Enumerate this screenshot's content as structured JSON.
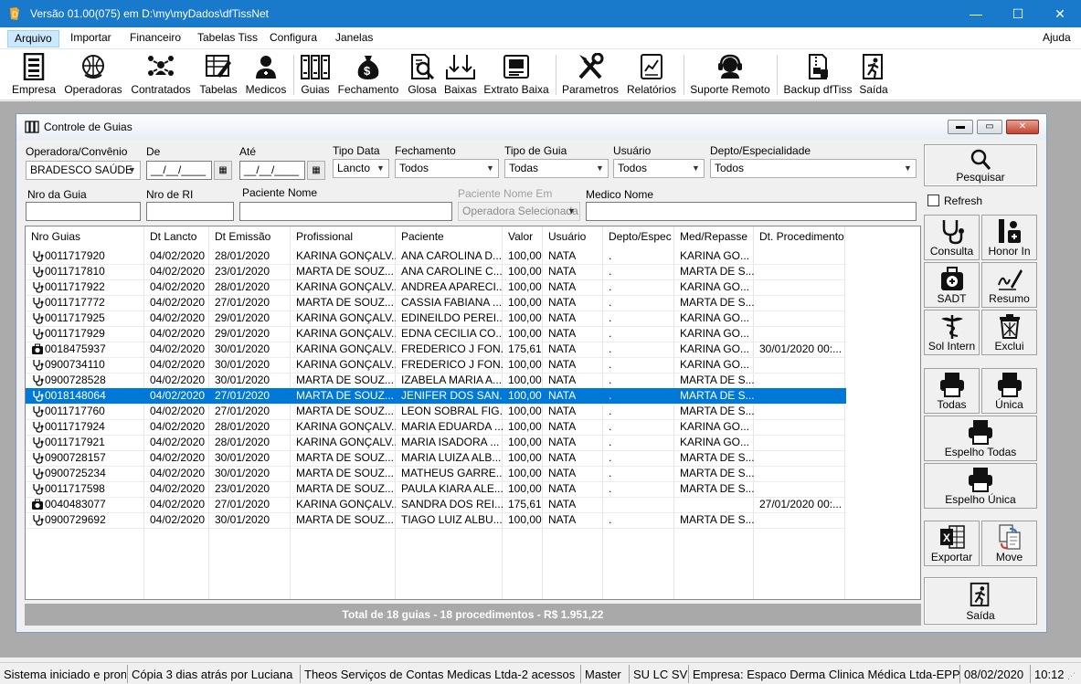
{
  "window": {
    "title": "Versão 01.00(075) em D:\\my\\myDados\\dfTissNet"
  },
  "menu": {
    "items": [
      "Arquivo",
      "Importar",
      "Financeiro",
      "Tabelas Tiss",
      "Configura",
      "Janelas"
    ],
    "help": "Ajuda"
  },
  "toolbar": {
    "items": [
      {
        "label": "Empresa",
        "icon": "building-list-icon"
      },
      {
        "label": "Operadoras",
        "icon": "globe-caduceus-icon"
      },
      {
        "label": "Contratados",
        "icon": "people-group-icon"
      },
      {
        "label": "Tabelas",
        "icon": "table-pencil-icon"
      },
      {
        "label": "Medicos",
        "icon": "doctor-icon"
      },
      {
        "label": "Guias",
        "icon": "guide-books-icon"
      },
      {
        "label": "Fechamento",
        "icon": "money-bag-icon"
      },
      {
        "label": "Glosa",
        "icon": "document-search-icon"
      },
      {
        "label": "Baixas",
        "icon": "download-arrows-icon"
      },
      {
        "label": "Extrato Baixa",
        "icon": "printer-statement-icon"
      },
      {
        "label": "Parametros",
        "icon": "tools-icon"
      },
      {
        "label": "Relatórios",
        "icon": "report-chart-icon"
      },
      {
        "label": "Suporte Remoto",
        "icon": "headset-support-icon"
      },
      {
        "label": "Backup dfTiss",
        "icon": "zip-backup-icon"
      },
      {
        "label": "Saída",
        "icon": "exit-running-icon"
      }
    ]
  },
  "child": {
    "title": "Controle de Guias",
    "filters": {
      "operadora_label": "Operadora/Convênio",
      "operadora_value": "BRADESCO SAÚDE",
      "de_label": "De",
      "de_value": "__/__/____",
      "ate_label": "Até",
      "ate_value": "__/__/____",
      "tipo_data_label": "Tipo Data",
      "tipo_data_value": "Lancto",
      "fechamento_label": "Fechamento",
      "fechamento_value": "Todos",
      "tipo_guia_label": "Tipo de Guia",
      "tipo_guia_value": "Todas",
      "usuario_label": "Usuário",
      "usuario_value": "Todos",
      "depto_label": "Depto/Especialidade",
      "depto_value": "Todos",
      "nro_guia_label": "Nro da Guia",
      "nro_ri_label": "Nro de RI",
      "paciente_label": "Paciente Nome",
      "paciente_em_label": "Paciente Nome Em",
      "paciente_em_value": "Operadora Selecionada",
      "medico_label": "Medico Nome",
      "refresh_label": "Refresh"
    },
    "grid": {
      "columns": [
        "Nro Guias",
        "Dt Lancto",
        "Dt Emissão",
        "Profissional",
        "Paciente",
        "Valor",
        "Usuário",
        "Depto/Espec",
        "Med/Repasse",
        "Dt. Procedimento"
      ],
      "rows": [
        {
          "icon": "stethoscope",
          "cells": [
            "0011717920",
            "04/02/2020",
            "28/01/2020",
            "KARINA GONÇALV...",
            "ANA CAROLINA D...",
            "100,00",
            "NATA",
            ".",
            "KARINA GO...",
            ""
          ]
        },
        {
          "icon": "stethoscope",
          "cells": [
            "0011717810",
            "04/02/2020",
            "23/01/2020",
            "MARTA DE SOUZ...",
            "ANA CAROLINE C...",
            "100,00",
            "NATA",
            ".",
            "MARTA DE S...",
            ""
          ]
        },
        {
          "icon": "stethoscope",
          "cells": [
            "0011717922",
            "04/02/2020",
            "28/01/2020",
            "KARINA GONÇALV...",
            "ANDREA APARECI...",
            "100,00",
            "NATA",
            ".",
            "KARINA GO...",
            ""
          ]
        },
        {
          "icon": "stethoscope",
          "cells": [
            "0011717772",
            "04/02/2020",
            "27/01/2020",
            "MARTA DE SOUZ...",
            "CASSIA FABIANA ...",
            "100,00",
            "NATA",
            ".",
            "MARTA DE S...",
            ""
          ]
        },
        {
          "icon": "stethoscope",
          "cells": [
            "0011717925",
            "04/02/2020",
            "29/01/2020",
            "KARINA GONÇALV...",
            "EDINEILDO PEREI...",
            "100,00",
            "NATA",
            ".",
            "KARINA GO...",
            ""
          ]
        },
        {
          "icon": "stethoscope",
          "cells": [
            "0011717929",
            "04/02/2020",
            "29/01/2020",
            "KARINA GONÇALV...",
            "EDNA CECILIA CO...",
            "100,00",
            "NATA",
            ".",
            "KARINA GO...",
            ""
          ]
        },
        {
          "icon": "sadt",
          "cells": [
            "0018475937",
            "04/02/2020",
            "30/01/2020",
            "KARINA GONÇALV...",
            "FREDERICO J FON...",
            "175,61",
            "NATA",
            ".",
            "KARINA GO...",
            "30/01/2020 00:..."
          ]
        },
        {
          "icon": "stethoscope",
          "cells": [
            "0900734110",
            "04/02/2020",
            "30/01/2020",
            "KARINA GONÇALV...",
            "FREDERICO J FON...",
            "100,00",
            "NATA",
            ".",
            "KARINA GO...",
            ""
          ]
        },
        {
          "icon": "stethoscope",
          "cells": [
            "0900728528",
            "04/02/2020",
            "30/01/2020",
            "MARTA DE SOUZ...",
            "IZABELA MARIA A...",
            "100,00",
            "NATA",
            ".",
            "MARTA DE S...",
            ""
          ]
        },
        {
          "icon": "stethoscope",
          "selected": true,
          "cells": [
            "0018148064",
            "04/02/2020",
            "27/01/2020",
            "MARTA DE SOUZ...",
            "JENIFER DOS SAN...",
            "100,00",
            "NATA",
            ".",
            "MARTA DE S...",
            ""
          ]
        },
        {
          "icon": "stethoscope",
          "cells": [
            "0011717760",
            "04/02/2020",
            "27/01/2020",
            "MARTA DE SOUZ...",
            "LEON SOBRAL FIG...",
            "100,00",
            "NATA",
            ".",
            "MARTA DE S...",
            ""
          ]
        },
        {
          "icon": "stethoscope",
          "cells": [
            "0011717924",
            "04/02/2020",
            "28/01/2020",
            "KARINA GONÇALV...",
            "MARIA EDUARDA ...",
            "100,00",
            "NATA",
            ".",
            "KARINA GO...",
            ""
          ]
        },
        {
          "icon": "stethoscope",
          "cells": [
            "0011717921",
            "04/02/2020",
            "28/01/2020",
            "KARINA GONÇALV...",
            "MARIA ISADORA ...",
            "100,00",
            "NATA",
            ".",
            "KARINA GO...",
            ""
          ]
        },
        {
          "icon": "stethoscope",
          "cells": [
            "0900728157",
            "04/02/2020",
            "30/01/2020",
            "MARTA DE SOUZ...",
            "MARIA LUIZA ALB...",
            "100,00",
            "NATA",
            ".",
            "MARTA DE S...",
            ""
          ]
        },
        {
          "icon": "stethoscope",
          "cells": [
            "0900725234",
            "04/02/2020",
            "30/01/2020",
            "MARTA DE SOUZ...",
            "MATHEUS GARRE...",
            "100,00",
            "NATA",
            ".",
            "MARTA DE S...",
            ""
          ]
        },
        {
          "icon": "stethoscope",
          "cells": [
            "0011717598",
            "04/02/2020",
            "23/01/2020",
            "MARTA DE SOUZ...",
            "PAULA KIARA ALE...",
            "100,00",
            "NATA",
            ".",
            "MARTA DE S...",
            ""
          ]
        },
        {
          "icon": "sadt",
          "cells": [
            "0040483077",
            "04/02/2020",
            "27/01/2020",
            "KARINA GONÇALV...",
            "SANDRA DOS REI...",
            "175,61",
            "NATA",
            "",
            "",
            "27/01/2020 00:..."
          ]
        },
        {
          "icon": "stethoscope",
          "cells": [
            "0900729692",
            "04/02/2020",
            "30/01/2020",
            "MARTA DE SOUZ...",
            "TIAGO LUIZ ALBU...",
            "100,00",
            "NATA",
            ".",
            "MARTA DE S...",
            ""
          ]
        }
      ],
      "total": "Total de 18 guias - 18 procedimentos - R$ 1.951,22"
    },
    "actions": {
      "pesquisar": "Pesquisar",
      "consulta": "Consulta",
      "honor_in": "Honor In",
      "sadt": "SADT",
      "resumo": "Resumo",
      "sol_intern": "Sol Intern",
      "exclui": "Exclui",
      "todas": "Todas",
      "unica": "Única",
      "espelho_todas": "Espelho Todas",
      "espelho_unica": "Espelho Única",
      "exportar": "Exportar",
      "move": "Move",
      "saida": "Saída"
    }
  },
  "status": {
    "s1": "Sistema iniciado e pronto",
    "s2": "Cópia 3 dias atrás por Luciana",
    "s3": "Theos Serviços de Contas Medicas Ltda-2 acessos",
    "s4": "Master",
    "s5": "SU LC SV",
    "s6": "Empresa: Espaco Derma Clinica Médica Ltda-EPP",
    "s7": "08/02/2020",
    "s8": "10:12"
  },
  "colors": {
    "titlebar": "#1979ca",
    "selection": "#0078d7",
    "total_bar": "#a9a9a9"
  }
}
